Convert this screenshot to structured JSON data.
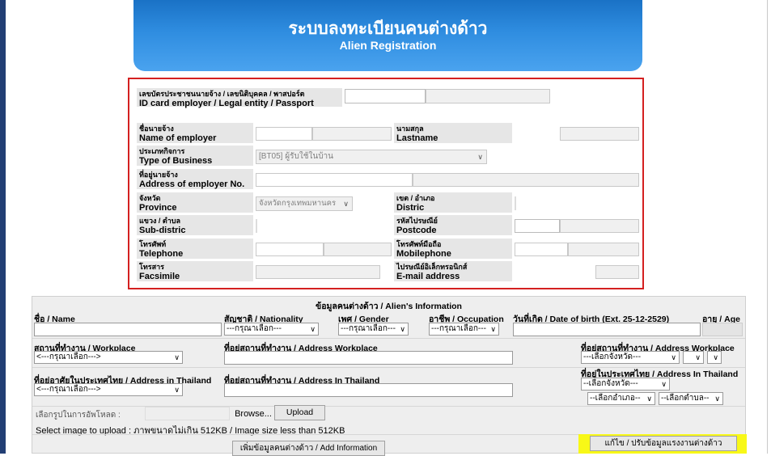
{
  "header": {
    "title_thai": "ระบบลงทะเบียนคนต่างด้าว",
    "title_en": "Alien Registration"
  },
  "employer": {
    "id_label_th": "เลขบัตรประชาชนนายจ้าง / เลขนิติบุคคล / พาสปอร์ต",
    "id_label_en": "ID card employer / Legal entity / Passport",
    "name_label_th": "ชื่อนายจ้าง",
    "name_label_en": "Name of employer",
    "lastname_label_th": "นามสกุล",
    "lastname_label_en": "Lastname",
    "business_label_th": "ประเภทกิจการ",
    "business_label_en": "Type of Business",
    "business_value": "[BT05] ผู้รับใช้ในบ้าน",
    "address_label_th": "ที่อยู่นายจ้าง",
    "address_label_en": "Address of employer No.",
    "province_label_th": "จังหวัด",
    "province_label_en": "Province",
    "province_value": "จังหวัดกรุงเทพมหานคร",
    "district_label_th": "เขต / อำเภอ",
    "district_label_en": "Distric",
    "subdistrict_label_th": "แขวง / ตำบล",
    "subdistrict_label_en": "Sub-distric",
    "postcode_label_th": "รหัสไปรษณีย์",
    "postcode_label_en": "Postcode",
    "telephone_label_th": "โทรศัพท์",
    "telephone_label_en": "Telephone",
    "mobile_label_th": "โทรศัพท์มือถือ",
    "mobile_label_en": "Mobilephone",
    "fax_label_th": "โทรสาร",
    "fax_label_en": "Facsimile",
    "email_label_th": "ไปรษณีย์อิเล็กทรอนิกส์",
    "email_label_en": "E-mail address"
  },
  "alien": {
    "section_title": "ข้อมูลคนต่างด้าว / Alien's Information",
    "name_label": "ชื่อ / Name",
    "nationality_label": "สัญชาติ / Nationality",
    "gender_label": "เพศ / Gender",
    "occupation_label": "อาชีพ / Occupation",
    "dob_label": "วันที่เกิด / Date of birth (Ext. 25-12-2529)",
    "age_label": "อายุ / Age",
    "select_please": "---กรุณาเลือก---",
    "workplace_label": "สถานที่ทำงาน / Workplace",
    "workplace_select": "<---กรุณาเลือก--->",
    "workplace_address_label": "ที่อยู่สถานที่ทำงาน / Address Workplace",
    "workplace_address_label2": "ที่อยู่สถานที่ทำงาน / Address Workplace",
    "select_province": "---เลือกจังหวัด---",
    "thai_address_label": "ที่อยู่อาศัยในประเทศไทย / Address in Thailand",
    "thai_address_select": "<---กรุณาเลือก--->",
    "thai_workplace_address_label": "ที่อยู่สถานที่ทำงาน / Address In Thailand",
    "thai_address_label2": "ที่อยู่ในประเทศไทย / Address In Thailand",
    "select_province2": "--เลือกจังหวัด---",
    "select_amphoe": "--เลือกอำเภอ--",
    "select_tambon": "--เลือกตำบล--",
    "photo_label": "เลือกรูปในการอัพโหลด :",
    "browse_label": "Browse...",
    "upload_label": "Upload",
    "upload_hint": "Select image to upload : ภาพขนาดไม่เกิน 512KB / Image size less than 512KB",
    "add_button": "เพิ่มข้อมูลคนต่างด้าว / Add Information",
    "edit_button": "แก้ไข / ปรับข้อมูลแรงงานต่างด้าว"
  },
  "colors": {
    "banner": "#2f8de0",
    "employer_border": "#d42020",
    "highlight": "#f8f817",
    "side_bar": "#223e74"
  }
}
